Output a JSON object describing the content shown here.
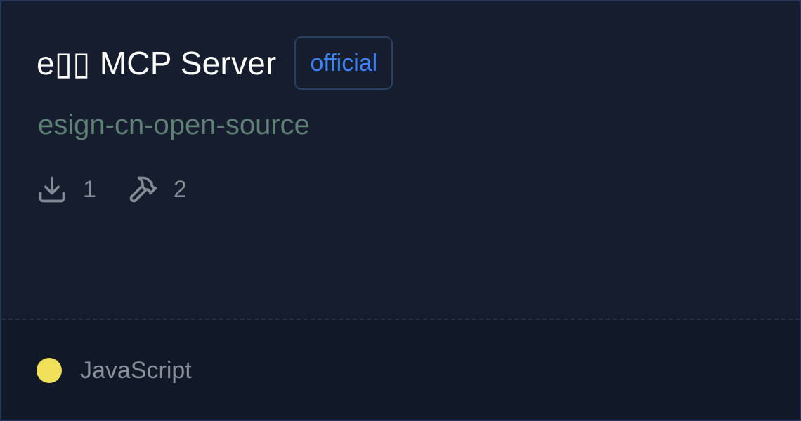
{
  "card": {
    "title": "e▯▯ MCP Server",
    "badge": "official",
    "subtitle": "esign-cn-open-source",
    "stats": {
      "downloads": {
        "icon": "download-icon",
        "value": "1"
      },
      "tools": {
        "icon": "hammer-icon",
        "value": "2"
      }
    },
    "footer": {
      "language": "JavaScript",
      "language_color": "#f1e05a"
    }
  },
  "colors": {
    "background": "#151d2e",
    "footer_background": "#111827",
    "badge_text": "#3b82f6",
    "subtitle": "#5f8075"
  }
}
